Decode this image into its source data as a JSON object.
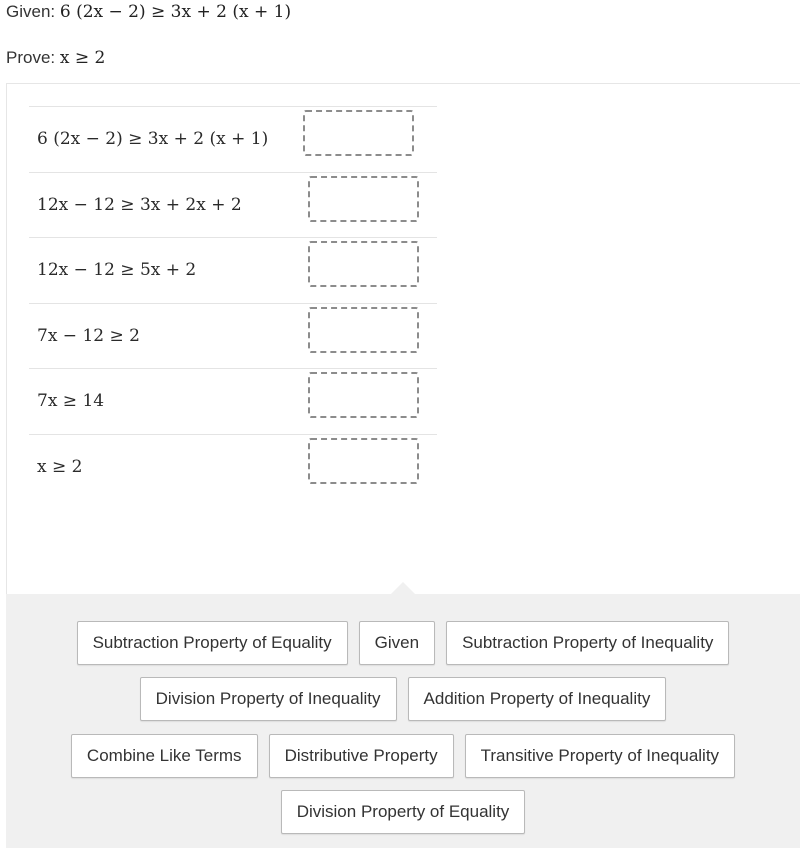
{
  "given": {
    "label": "Given:",
    "expression": "6 (2x − 2) ≥ 3x + 2 (x + 1)"
  },
  "prove": {
    "label": "Prove:",
    "expression": "x ≥ 2"
  },
  "proof": {
    "rows": [
      {
        "statement": "6 (2x − 2) ≥ 3x + 2 (x + 1)",
        "reason": ""
      },
      {
        "statement": "12x − 12 ≥ 3x + 2x + 2",
        "reason": ""
      },
      {
        "statement": "12x − 12 ≥ 5x + 2",
        "reason": ""
      },
      {
        "statement": "7x − 12 ≥ 2",
        "reason": ""
      },
      {
        "statement": "7x ≥ 14",
        "reason": ""
      },
      {
        "statement": "x ≥ 2",
        "reason": ""
      }
    ]
  },
  "reason_bank": {
    "rows": [
      [
        "Subtraction Property of Equality",
        "Given",
        "Subtraction Property of Inequality"
      ],
      [
        "Division Property of Inequality",
        "Addition Property of Inequality"
      ],
      [
        "Combine Like Terms",
        "Distributive Property",
        "Transitive Property of Inequality"
      ],
      [
        "Division Property of Equality"
      ]
    ]
  },
  "colors": {
    "bank_background": "#f0f0f0",
    "chip_border": "#b9b9b9",
    "drop_border": "#8c8c8c",
    "text": "#333333"
  }
}
